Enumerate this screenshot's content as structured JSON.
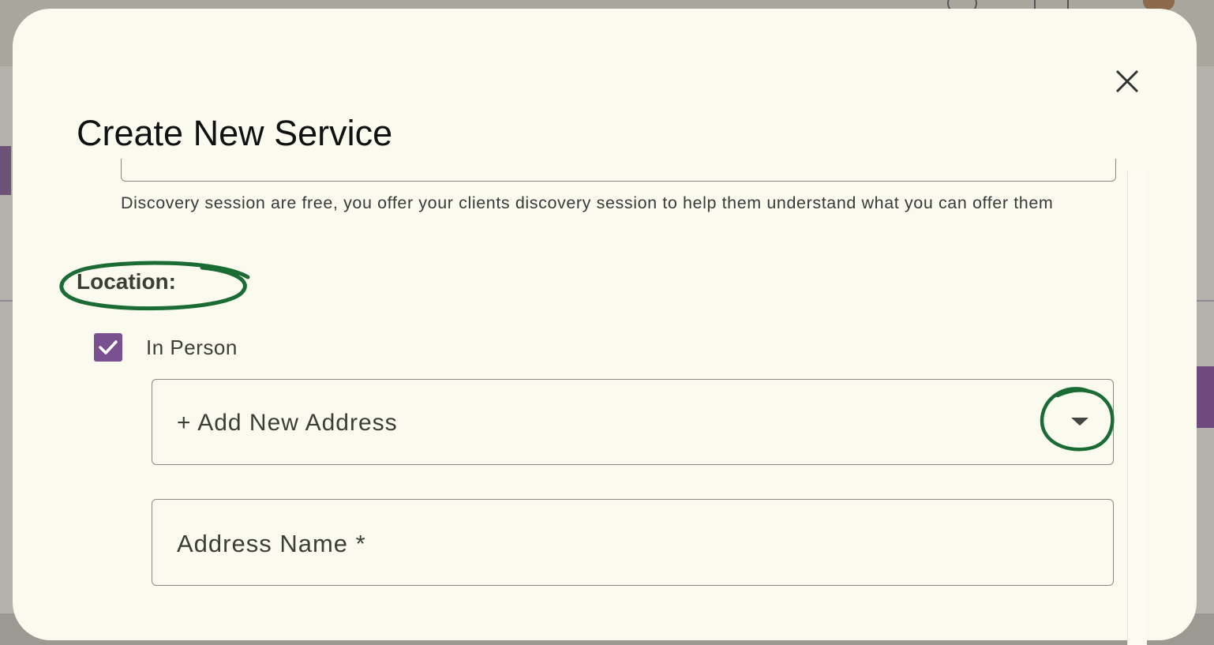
{
  "modal": {
    "title": "Create New Service",
    "discovery_hint": " Discovery session are free, you offer your clients discovery session to help them understand what you can offer them",
    "location": {
      "label": "Location:",
      "in_person": {
        "label": "In Person",
        "checked": true
      },
      "address_select": {
        "value": "+ Add New Address"
      },
      "address_name": {
        "placeholder": "Address Name *"
      }
    }
  },
  "icons": {
    "close": "close-icon",
    "check": "check-icon",
    "caret": "chevron-down-icon"
  },
  "colors": {
    "accent": "#7a5190",
    "annotation": "#1a6b34",
    "modal_bg": "#fafaef"
  }
}
